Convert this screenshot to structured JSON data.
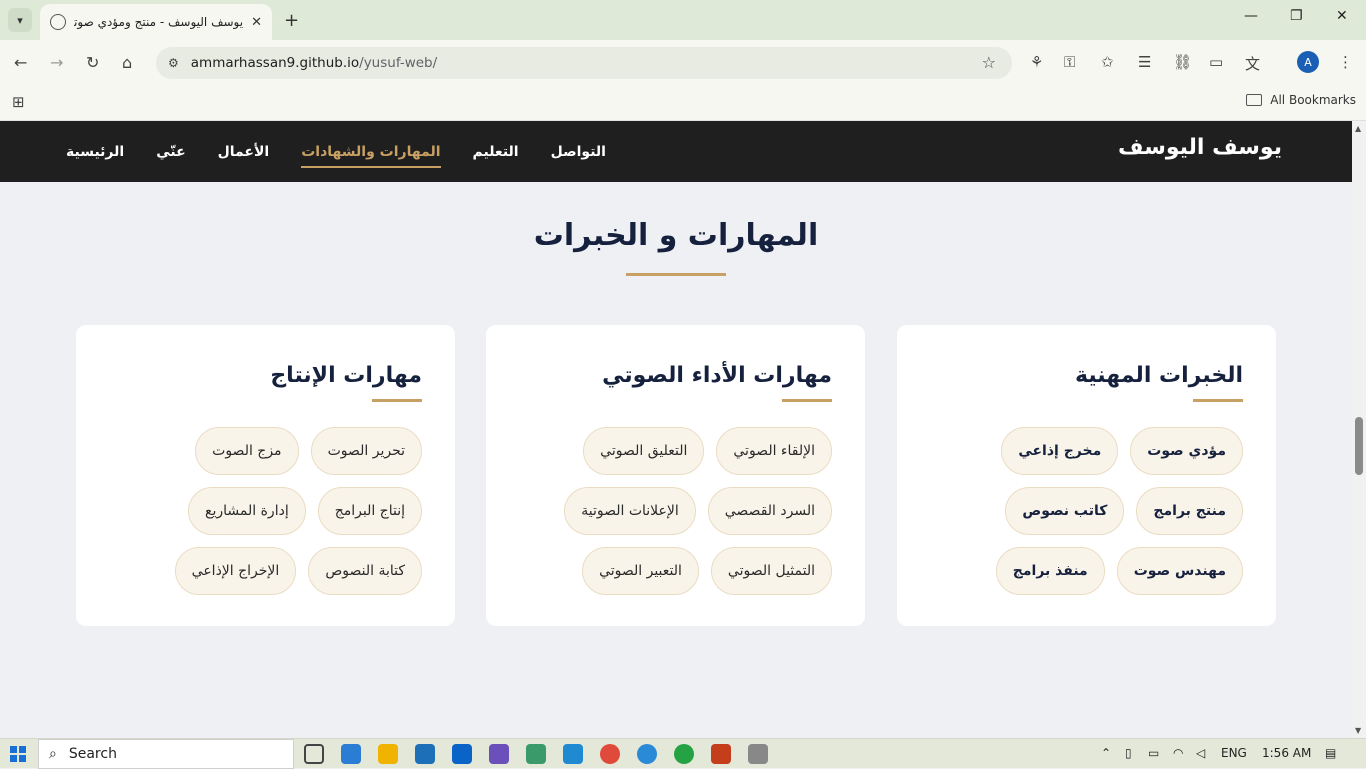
{
  "browser": {
    "tab_title": "يوسف اليوسف - منتج ومؤدي صوتي",
    "url_host": "ammarhassan9.github.io",
    "url_path": "/yusuf-web/",
    "all_bookmarks": "All Bookmarks",
    "avatar_letter": "A"
  },
  "site": {
    "brand": "يوسف اليوسف",
    "nav": [
      "الرئيسية",
      "عنّي",
      "الأعمال",
      "المهارات والشهادات",
      "التعليم",
      "التواصل"
    ],
    "active_nav": "المهارات والشهادات",
    "section_title": "المهارات و الخبرات",
    "cards": [
      {
        "title": "الخبرات المهنية",
        "items": [
          "مؤدي صوت",
          "مخرج إذاعي",
          "منتج برامج",
          "كاتب نصوص",
          "مهندس صوت",
          "منفذ برامج"
        ]
      },
      {
        "title": "مهارات الأداء الصوتي",
        "items": [
          "الإلقاء الصوتي",
          "التعليق الصوتي",
          "السرد القصصي",
          "الإعلانات الصوتية",
          "التمثيل الصوتي",
          "التعبير الصوتي"
        ]
      },
      {
        "title": "مهارات الإنتاج",
        "items": [
          "تحرير الصوت",
          "مزج الصوت",
          "إنتاج البرامج",
          "إدارة المشاريع",
          "كتابة النصوص",
          "الإخراج الإذاعي"
        ]
      }
    ],
    "accent_color": "#c9a063",
    "dark_color": "#1f1f1f"
  },
  "taskbar": {
    "search_label": "Search",
    "lang": "ENG",
    "time": "1:56 AM"
  }
}
